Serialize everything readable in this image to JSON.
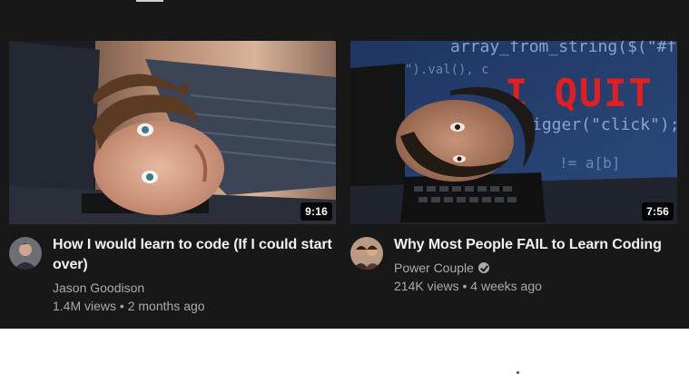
{
  "videos": [
    {
      "title": "How I would learn to code (If I could start over)",
      "channel": "Jason Goodison",
      "verified": false,
      "views": "1.4M views",
      "age": "2 months ago",
      "duration": "9:16",
      "avatar_icon": "channel-avatar-icon"
    },
    {
      "title": "Why Most People FAIL to Learn Coding",
      "channel": "Power Couple",
      "verified": true,
      "views": "214K views",
      "age": "4 weeks ago",
      "duration": "7:56",
      "avatar_icon": "channel-avatar-icon",
      "thumbnail_text": "I QUIT",
      "thumbnail_code": [
        "array_from_string($(\"#f",
        "\").val(), c",
        "igger(\"click\");",
        "!= a[b]"
      ]
    }
  ],
  "stats_separator": " • ",
  "colors": {
    "panel_bg": "#181818",
    "title_text": "#f1f1f1",
    "secondary_text": "#aaaaaa",
    "quit_red": "#e02020"
  }
}
